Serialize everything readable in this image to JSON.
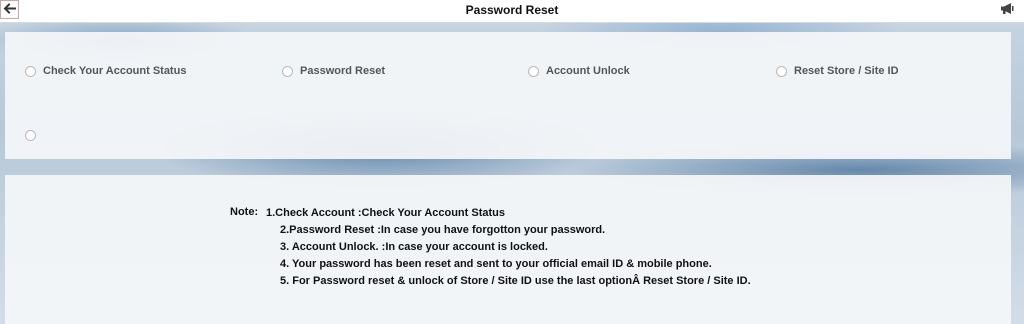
{
  "header": {
    "title": "Password Reset",
    "back_icon": "arrow-left-icon",
    "announce_icon": "megaphone-icon"
  },
  "options": [
    {
      "label": "Check Your Account Status"
    },
    {
      "label": "Password Reset"
    },
    {
      "label": "Account Unlock"
    },
    {
      "label": "Reset Store / Site ID"
    },
    {
      "label": ""
    }
  ],
  "notes": {
    "label": "Note:",
    "lines": [
      "1.Check Account :Check Your Account Status",
      "2.Password Reset :In case you have forgotton your password.",
      "3. Account Unlock. :In case your account is locked.",
      "4. Your password has been reset and sent to your official email ID & mobile phone.",
      "5. For Password reset & unlock of Store / Site ID use the last optionÂ Reset Store / Site ID."
    ]
  },
  "colors": {
    "topbar_bg": "#ffffff",
    "panel_bg": "#f4f6f9",
    "option_text": "#555555",
    "note_text": "#111111"
  }
}
